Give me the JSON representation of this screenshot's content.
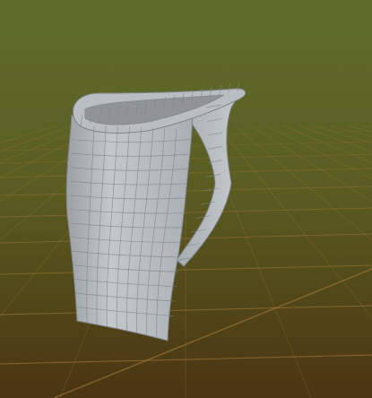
{
  "viewport": {
    "background_top": "#5d6b2a",
    "background_mid": "#5a5a20",
    "background_bottom": "#4a3512",
    "grid_color": "#a07a3c",
    "mesh_fill": "#b6bcc0",
    "mesh_shade": "#8d9397",
    "mesh_line": "#7e858a"
  },
  "model": {
    "icon": "mesh-object-icon"
  }
}
